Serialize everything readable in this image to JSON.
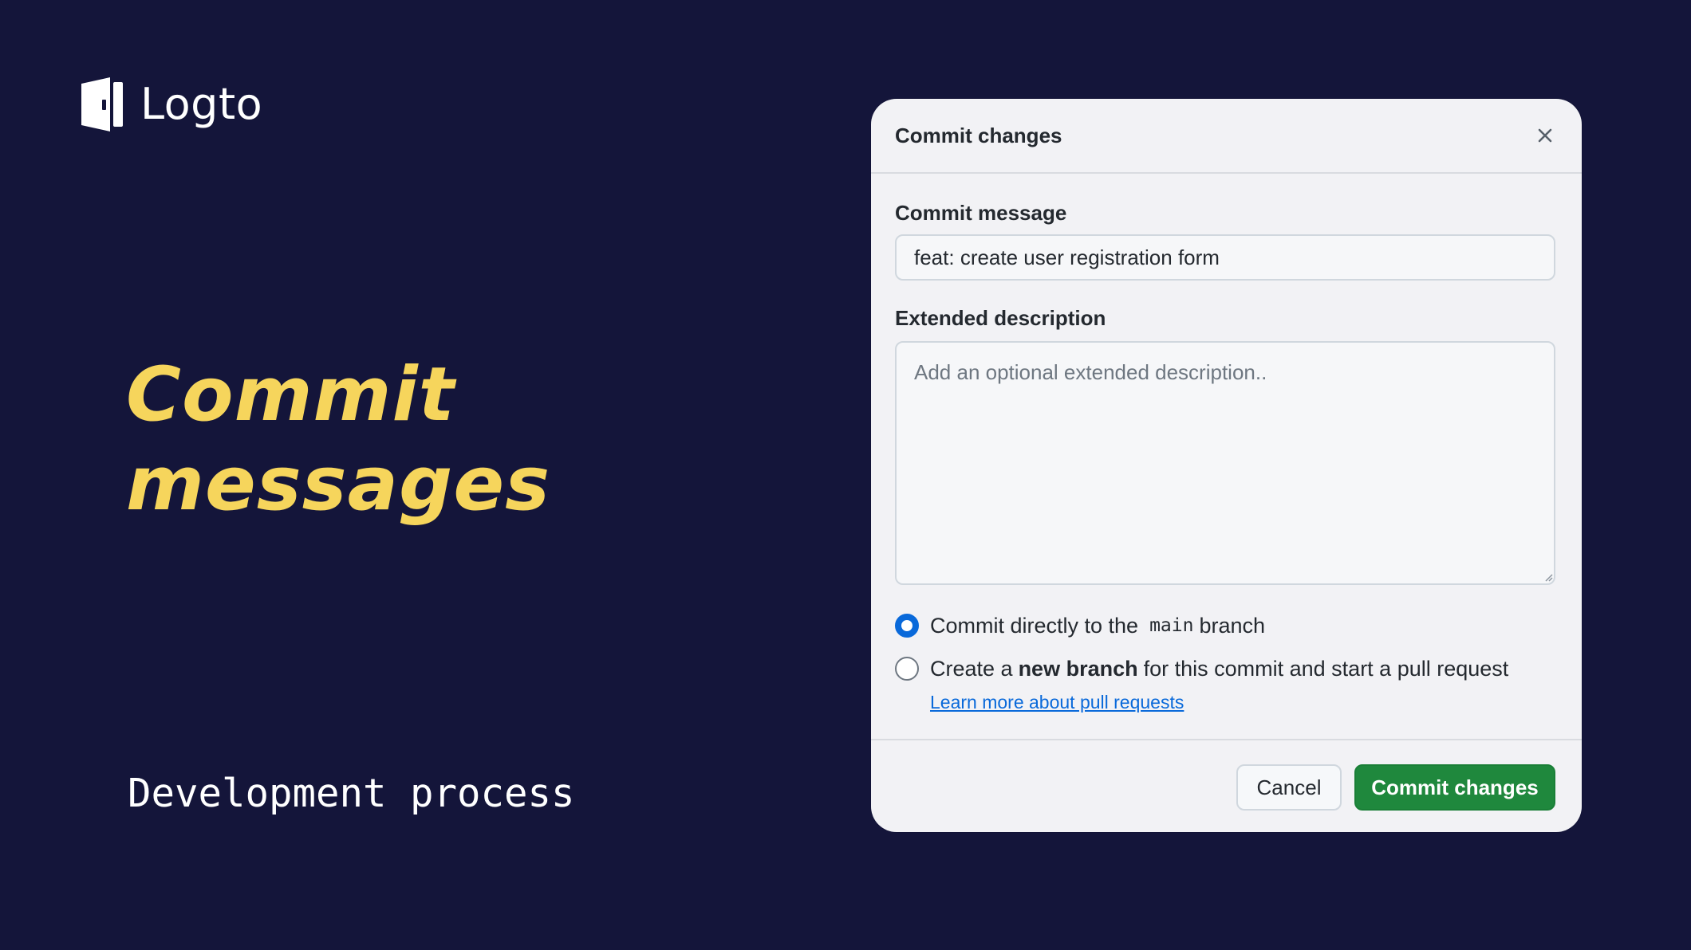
{
  "brand": {
    "name": "Logto",
    "logo_icon": "door-logo-icon"
  },
  "slide": {
    "headline_line1": "Commit",
    "headline_line2": "messages",
    "subtitle": "Development process",
    "colors": {
      "background": "#14153a",
      "headline": "#f6d55c",
      "subtitle": "#ffffff"
    }
  },
  "dialog": {
    "title": "Commit changes",
    "close_icon": "close-icon",
    "commit_message_label": "Commit message",
    "commit_message_value": "feat: create user registration form",
    "extended_description_label": "Extended description",
    "extended_description_placeholder": "Add an optional extended description..",
    "options": [
      {
        "selected": true,
        "prefix": "Commit directly to the",
        "code": "main",
        "suffix": "branch"
      },
      {
        "selected": false,
        "prefix": "Create a",
        "bold": "new branch",
        "suffix": "for this commit and start a pull request"
      }
    ],
    "learn_more_link": "Learn more about pull requests",
    "cancel_label": "Cancel",
    "commit_label": "Commit changes",
    "colors": {
      "primary_button": "#1f883d",
      "radio_selected": "#0969da",
      "link": "#0969da"
    }
  }
}
